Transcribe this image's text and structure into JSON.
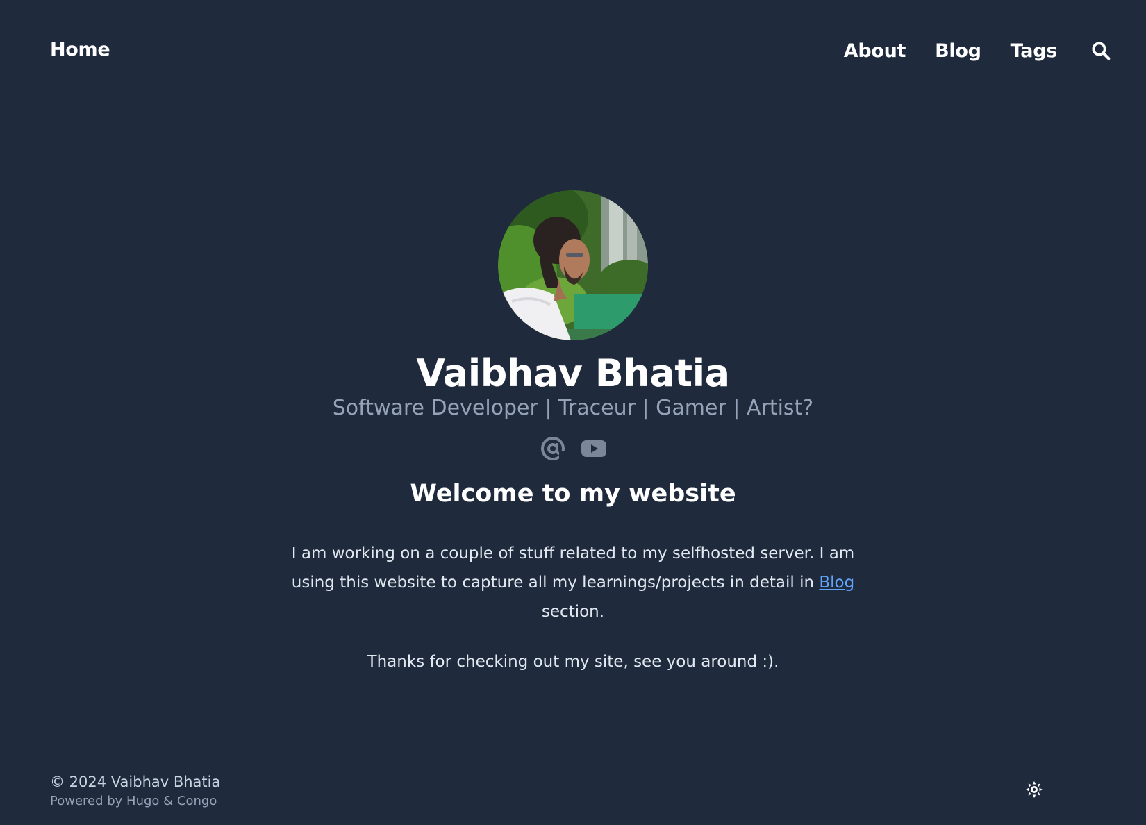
{
  "nav": {
    "home": "Home",
    "links": [
      "About",
      "Blog",
      "Tags"
    ],
    "search_icon": "search-icon"
  },
  "hero": {
    "name": "Vaibhav Bhatia",
    "tagline": "Software Developer | Traceur | Gamer | Artist?",
    "social_icons": [
      "at-icon",
      "youtube-icon"
    ]
  },
  "content": {
    "heading": "Welcome to my website",
    "intro_before": "I am working on a couple of stuff related to my selfhosted server. I am using this website to capture all my learnings/projects in detail in ",
    "intro_link": "Blog",
    "intro_after": " section.",
    "thanks": "Thanks for checking out my site, see you around :)."
  },
  "footer": {
    "copyright": "© 2024 Vaibhav Bhatia",
    "powered": "Powered by Hugo & Congo",
    "theme_icon": "sun-icon"
  },
  "colors": {
    "background": "#1f2a3d",
    "text": "#ffffff",
    "muted": "#94a3b8",
    "link": "#60a5fa"
  }
}
